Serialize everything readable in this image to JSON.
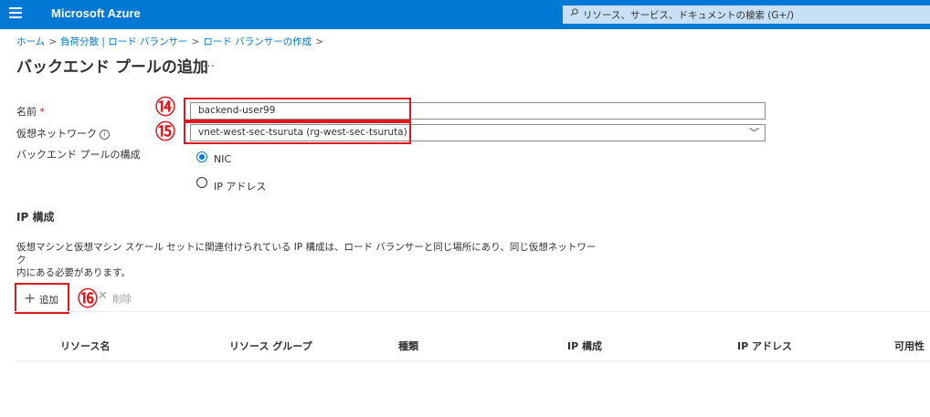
{
  "topbar": {
    "brand": "Microsoft Azure",
    "search_placeholder": "リソース、サービス、ドキュメントの検索 (G+/)"
  },
  "breadcrumb": [
    "ホーム",
    "負荷分散 | ロード バランサー",
    "ロード バランサーの作成"
  ],
  "breadcrumb_sep": ">",
  "page": {
    "title": "バックエンド プールの追加",
    "more": "…"
  },
  "form": {
    "name_label": "名前",
    "name_required": "*",
    "name_value": "backend-user99",
    "vnet_label": "仮想ネットワーク",
    "vnet_info": "i",
    "vnet_value": "vnet-west-sec-tsuruta (rg-west-sec-tsuruta)",
    "vnet_chevron": "﹀",
    "config_label": "バックエンド プールの構成",
    "config_options": [
      {
        "label": "NIC",
        "selected": true
      },
      {
        "label": "IP アドレス",
        "selected": false
      }
    ]
  },
  "ip_config": {
    "heading": "IP 構成",
    "description_line1": "仮想マシンと仮想マシン スケール セットに関連付けられている IP 構成は、ロード バランサーと同じ場所にあり、同じ仮想ネットワーク",
    "description_line2": "内にある必要があります。"
  },
  "toolbar": {
    "add_icon": "+",
    "add_label": "追加",
    "delete_icon": "✕",
    "delete_label": "削除"
  },
  "table": {
    "headers": [
      "リソース名",
      "リソース グループ",
      "種類",
      "IP 構成",
      "IP アドレス",
      "可用性"
    ]
  },
  "annotations": {
    "a14": "⑭",
    "a15": "⑮",
    "a16": "⑯",
    "color": "#e0191f"
  },
  "colors": {
    "brand": "#0078d4",
    "search_bg": "#c7e0f4",
    "annotation": "#e0191f"
  }
}
